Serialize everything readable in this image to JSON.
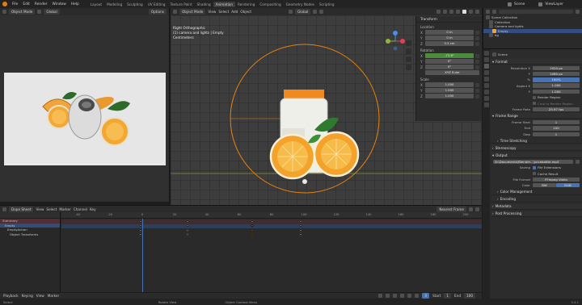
{
  "menubar": {
    "menus": [
      "File",
      "Edit",
      "Render",
      "Window",
      "Help"
    ],
    "workspaces": [
      "Layout",
      "Modeling",
      "Sculpting",
      "UV Editing",
      "Texture Paint",
      "Shading",
      "Animation",
      "Rendering",
      "Compositing",
      "Geometry Nodes",
      "Scripting"
    ],
    "active_workspace": "Animation",
    "scene": "Scene",
    "view_layer": "ViewLayer"
  },
  "image_editor": {
    "mode": "Object Mode",
    "view": "View",
    "gizmo": "Gizmo",
    "global": "Global",
    "options": "Options"
  },
  "viewport": {
    "mode": "Object Mode",
    "menus": [
      "View",
      "Select",
      "Add",
      "Object"
    ],
    "transform_orientation": "Global",
    "overlay_lines": [
      "Right Orthographic",
      "(1) camera and lights | Empty",
      "Centimeters"
    ]
  },
  "n_panel": {
    "title": "Transform",
    "location_label": "Location",
    "location": [
      {
        "axis": "X",
        "value": "0 m"
      },
      {
        "axis": "Y",
        "value": "0 m"
      },
      {
        "axis": "Z",
        "value": "5.5 cm"
      }
    ],
    "rotation_label": "Rotation",
    "rotation": [
      {
        "axis": "X",
        "value": "-71.6°"
      },
      {
        "axis": "Y",
        "value": "0°"
      },
      {
        "axis": "Z",
        "value": "0°"
      }
    ],
    "rotation_mode": "XYZ Euler",
    "scale_label": "Scale",
    "scale": [
      {
        "axis": "X",
        "value": "1.000"
      },
      {
        "axis": "Y",
        "value": "1.000"
      },
      {
        "axis": "Z",
        "value": "1.000"
      }
    ]
  },
  "dope_sheet": {
    "editor_mode": "Dope Sheet",
    "menus": [
      "View",
      "Select",
      "Marker",
      "Channel",
      "Key"
    ],
    "interpolation": "Nearest Frame",
    "channels": [
      "Summary",
      "Empty",
      "EmptyAction",
      "Object Transforms"
    ],
    "ruler_ticks": [
      {
        "frame": -40,
        "label": "-40"
      },
      {
        "frame": -20,
        "label": "-20"
      },
      {
        "frame": 0,
        "label": "0"
      },
      {
        "frame": 20,
        "label": "20"
      },
      {
        "frame": 40,
        "label": "40"
      },
      {
        "frame": 60,
        "label": "60"
      },
      {
        "frame": 80,
        "label": "80"
      },
      {
        "frame": 100,
        "label": "100"
      },
      {
        "frame": 120,
        "label": "120"
      },
      {
        "frame": 140,
        "label": "140"
      },
      {
        "frame": 160,
        "label": "160"
      },
      {
        "frame": 180,
        "label": "180"
      },
      {
        "frame": 200,
        "label": "200"
      }
    ],
    "frame_range": [
      -50,
      210
    ],
    "current_frame": 0,
    "keyframes": [
      -1,
      28,
      68,
      98
    ],
    "highlight_colors": {
      "summary_row": "#512e33",
      "selected_row": "#2f4e7a",
      "keyframe": "#e8e8e8",
      "selected_keyframe": "#f0a020",
      "playhead": "#4772b3"
    }
  },
  "playback": {
    "playback": "Playback",
    "keying": "Keying",
    "view": "View",
    "marker": "Marker",
    "current_frame": "0",
    "start_label": "Start",
    "start": "1",
    "end_label": "End",
    "end": "100"
  },
  "status_bar": {
    "select": "Select",
    "rotate": "Rotate View",
    "context": "Object Context Menu",
    "version": "3.4.1"
  },
  "outliner": {
    "items": [
      {
        "label": "Scene Collection",
        "indent": 0
      },
      {
        "label": "Collection",
        "indent": 1
      },
      {
        "label": "Camera and lights",
        "indent": 1
      },
      {
        "label": "Empty",
        "indent": 2,
        "selected": true
      },
      {
        "label": "bg",
        "indent": 1
      }
    ]
  },
  "properties": {
    "scene_name": "Scene",
    "format": {
      "title": "Format",
      "rows": [
        {
          "label": "Resolution X",
          "value": "1920 px"
        },
        {
          "label": "Y",
          "value": "1080 px"
        },
        {
          "label": "%",
          "value": "100%",
          "blue": true
        },
        {
          "label": "Aspect X",
          "value": "1.000"
        },
        {
          "label": "Y",
          "value": "1.000"
        }
      ],
      "render_region": "Render Region",
      "crop": "Crop to Render Region",
      "frame_rate_label": "Frame Rate",
      "frame_rate": "25.97 fps"
    },
    "frame_range": {
      "title": "Frame Range",
      "rows": [
        {
          "label": "Frame Start",
          "value": "1"
        },
        {
          "label": "End",
          "value": "100"
        },
        {
          "label": "Step",
          "value": "1"
        }
      ]
    },
    "time_stretching": "Time Stretching",
    "stereoscopy": "Stereoscopy",
    "output": {
      "title": "Output",
      "path": "D:\\Documents\\Blender...\\juicebottle.mp4",
      "saving_label": "Saving",
      "file_extensions": "File Extensions",
      "cache_result": "Cache Result",
      "file_format_label": "File Format",
      "file_format": "FFmpeg Video",
      "color_label": "Color",
      "color_bw": "BW",
      "color_rgb": "RGB"
    },
    "color_management": "Color Management",
    "encoding": "Encoding",
    "metadata": "Metadata",
    "post_processing": "Post Processing"
  }
}
